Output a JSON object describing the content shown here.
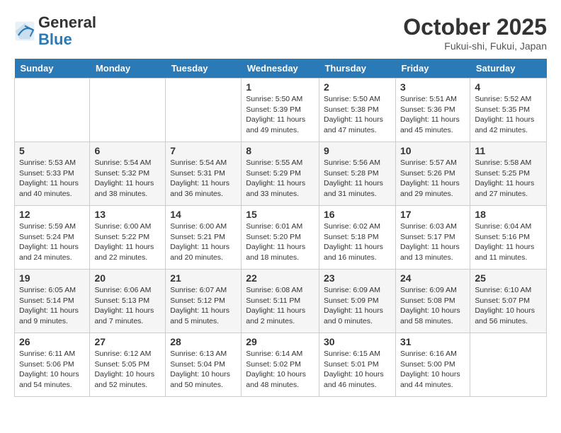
{
  "header": {
    "logo_general": "General",
    "logo_blue": "Blue",
    "month_title": "October 2025",
    "subtitle": "Fukui-shi, Fukui, Japan"
  },
  "weekdays": [
    "Sunday",
    "Monday",
    "Tuesday",
    "Wednesday",
    "Thursday",
    "Friday",
    "Saturday"
  ],
  "weeks": [
    [
      {
        "day": "",
        "info": ""
      },
      {
        "day": "",
        "info": ""
      },
      {
        "day": "",
        "info": ""
      },
      {
        "day": "1",
        "info": "Sunrise: 5:50 AM\nSunset: 5:39 PM\nDaylight: 11 hours\nand 49 minutes."
      },
      {
        "day": "2",
        "info": "Sunrise: 5:50 AM\nSunset: 5:38 PM\nDaylight: 11 hours\nand 47 minutes."
      },
      {
        "day": "3",
        "info": "Sunrise: 5:51 AM\nSunset: 5:36 PM\nDaylight: 11 hours\nand 45 minutes."
      },
      {
        "day": "4",
        "info": "Sunrise: 5:52 AM\nSunset: 5:35 PM\nDaylight: 11 hours\nand 42 minutes."
      }
    ],
    [
      {
        "day": "5",
        "info": "Sunrise: 5:53 AM\nSunset: 5:33 PM\nDaylight: 11 hours\nand 40 minutes."
      },
      {
        "day": "6",
        "info": "Sunrise: 5:54 AM\nSunset: 5:32 PM\nDaylight: 11 hours\nand 38 minutes."
      },
      {
        "day": "7",
        "info": "Sunrise: 5:54 AM\nSunset: 5:31 PM\nDaylight: 11 hours\nand 36 minutes."
      },
      {
        "day": "8",
        "info": "Sunrise: 5:55 AM\nSunset: 5:29 PM\nDaylight: 11 hours\nand 33 minutes."
      },
      {
        "day": "9",
        "info": "Sunrise: 5:56 AM\nSunset: 5:28 PM\nDaylight: 11 hours\nand 31 minutes."
      },
      {
        "day": "10",
        "info": "Sunrise: 5:57 AM\nSunset: 5:26 PM\nDaylight: 11 hours\nand 29 minutes."
      },
      {
        "day": "11",
        "info": "Sunrise: 5:58 AM\nSunset: 5:25 PM\nDaylight: 11 hours\nand 27 minutes."
      }
    ],
    [
      {
        "day": "12",
        "info": "Sunrise: 5:59 AM\nSunset: 5:24 PM\nDaylight: 11 hours\nand 24 minutes."
      },
      {
        "day": "13",
        "info": "Sunrise: 6:00 AM\nSunset: 5:22 PM\nDaylight: 11 hours\nand 22 minutes."
      },
      {
        "day": "14",
        "info": "Sunrise: 6:00 AM\nSunset: 5:21 PM\nDaylight: 11 hours\nand 20 minutes."
      },
      {
        "day": "15",
        "info": "Sunrise: 6:01 AM\nSunset: 5:20 PM\nDaylight: 11 hours\nand 18 minutes."
      },
      {
        "day": "16",
        "info": "Sunrise: 6:02 AM\nSunset: 5:18 PM\nDaylight: 11 hours\nand 16 minutes."
      },
      {
        "day": "17",
        "info": "Sunrise: 6:03 AM\nSunset: 5:17 PM\nDaylight: 11 hours\nand 13 minutes."
      },
      {
        "day": "18",
        "info": "Sunrise: 6:04 AM\nSunset: 5:16 PM\nDaylight: 11 hours\nand 11 minutes."
      }
    ],
    [
      {
        "day": "19",
        "info": "Sunrise: 6:05 AM\nSunset: 5:14 PM\nDaylight: 11 hours\nand 9 minutes."
      },
      {
        "day": "20",
        "info": "Sunrise: 6:06 AM\nSunset: 5:13 PM\nDaylight: 11 hours\nand 7 minutes."
      },
      {
        "day": "21",
        "info": "Sunrise: 6:07 AM\nSunset: 5:12 PM\nDaylight: 11 hours\nand 5 minutes."
      },
      {
        "day": "22",
        "info": "Sunrise: 6:08 AM\nSunset: 5:11 PM\nDaylight: 11 hours\nand 2 minutes."
      },
      {
        "day": "23",
        "info": "Sunrise: 6:09 AM\nSunset: 5:09 PM\nDaylight: 11 hours\nand 0 minutes."
      },
      {
        "day": "24",
        "info": "Sunrise: 6:09 AM\nSunset: 5:08 PM\nDaylight: 10 hours\nand 58 minutes."
      },
      {
        "day": "25",
        "info": "Sunrise: 6:10 AM\nSunset: 5:07 PM\nDaylight: 10 hours\nand 56 minutes."
      }
    ],
    [
      {
        "day": "26",
        "info": "Sunrise: 6:11 AM\nSunset: 5:06 PM\nDaylight: 10 hours\nand 54 minutes."
      },
      {
        "day": "27",
        "info": "Sunrise: 6:12 AM\nSunset: 5:05 PM\nDaylight: 10 hours\nand 52 minutes."
      },
      {
        "day": "28",
        "info": "Sunrise: 6:13 AM\nSunset: 5:04 PM\nDaylight: 10 hours\nand 50 minutes."
      },
      {
        "day": "29",
        "info": "Sunrise: 6:14 AM\nSunset: 5:02 PM\nDaylight: 10 hours\nand 48 minutes."
      },
      {
        "day": "30",
        "info": "Sunrise: 6:15 AM\nSunset: 5:01 PM\nDaylight: 10 hours\nand 46 minutes."
      },
      {
        "day": "31",
        "info": "Sunrise: 6:16 AM\nSunset: 5:00 PM\nDaylight: 10 hours\nand 44 minutes."
      },
      {
        "day": "",
        "info": ""
      }
    ]
  ]
}
